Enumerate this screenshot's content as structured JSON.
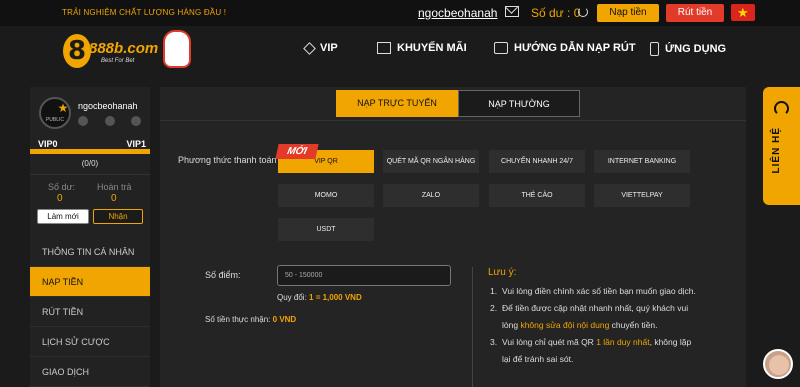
{
  "topbar": {
    "slogan": "TRẢI NGHIỆM CHẤT LƯỢNG HÀNG ĐẦU !",
    "username": "ngocbeohanah",
    "balance": "Số dư : 0",
    "deposit_label": "Nạp tiền",
    "withdraw_label": "Rút tiền"
  },
  "header": {
    "brand": "888b.com",
    "tagline": "Best For Bet",
    "nav": [
      {
        "label": "VIP"
      },
      {
        "label": "KHUYẾN MÃI"
      },
      {
        "label": "HƯỚNG DẪN NẠP RÚT"
      },
      {
        "label": "ỨNG DỤNG"
      }
    ]
  },
  "sidebar": {
    "badge": "PUBLIC",
    "username": "ngocbeohanah",
    "vip_from": "VIP0",
    "vip_to": "VIP1",
    "progress_text": "(0/0)",
    "balance_label": "Số dư:",
    "balance_value": "0",
    "rebate_label": "Hoàn trả",
    "rebate_value": "0",
    "refresh_label": "Làm mới",
    "receive_label": "Nhận",
    "menu": [
      {
        "label": "THÔNG TIN CÁ NHÂN"
      },
      {
        "label": "NẠP TIỀN"
      },
      {
        "label": "RÚT TIỀN"
      },
      {
        "label": "LỊCH SỬ CƯỢC"
      },
      {
        "label": "GIAO DỊCH"
      }
    ]
  },
  "main": {
    "tabs": [
      {
        "label": "NẠP TRỰC TUYẾN"
      },
      {
        "label": "NẠP THƯỜNG"
      }
    ],
    "payment_label": "Phương thức thanh toán",
    "new_badge": "MỚI",
    "payment_methods": [
      {
        "label": "VIP QR"
      },
      {
        "label": "QUÉT MÃ QR NGÂN HÀNG"
      },
      {
        "label": "CHUYỂN NHANH 24/7"
      },
      {
        "label": "INTERNET BANKING"
      },
      {
        "label": "MOMO"
      },
      {
        "label": "ZALO"
      },
      {
        "label": "THẺ CÀO"
      },
      {
        "label": "VIETTELPAY"
      },
      {
        "label": "USDT"
      }
    ],
    "amount_label": "Số điểm:",
    "amount_placeholder": "50 - 150000",
    "rate_prefix": "Quy đổi:",
    "rate_value": "1 = 1,000 VND",
    "receive_prefix": "Số tiền thực nhận:",
    "receive_value": "0 VND",
    "notes_title": "Lưu ý:",
    "notes": [
      {
        "num": "1.",
        "text": "Vui lòng điền chính xác số tiền bạn muốn giao dịch."
      },
      {
        "num": "2.",
        "a": "Để tiền được cập nhật nhanh nhất, quý khách vui lòng ",
        "hl": "không sửa đội nội dung",
        "b": " chuyển tiền."
      },
      {
        "num": "3.",
        "a": "Vui lòng chỉ quét mã QR ",
        "hl": "1 lần duy nhất",
        "b": ", không lặp lại để tránh sai sót."
      }
    ]
  },
  "support": {
    "label": "LIÊN HỆ"
  },
  "colors": {
    "accent": "#f0a500",
    "danger": "#e23b2a",
    "background": "#1b1b1b"
  }
}
